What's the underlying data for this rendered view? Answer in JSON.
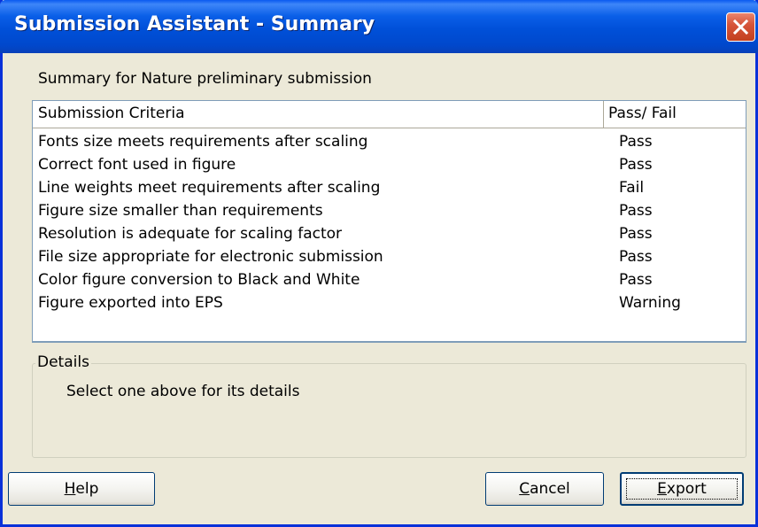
{
  "window": {
    "title": "Submission Assistant - Summary"
  },
  "summary": {
    "label": "Summary for Nature preliminary submission"
  },
  "table": {
    "columns": [
      "Submission Criteria",
      "Pass/ Fail"
    ],
    "rows": [
      {
        "criteria": "Fonts size meets requirements after scaling",
        "result": "Pass"
      },
      {
        "criteria": "Correct font used in figure",
        "result": "Pass"
      },
      {
        "criteria": "Line weights meet requirements after scaling",
        "result": "Fail"
      },
      {
        "criteria": "Figure size smaller than requirements",
        "result": "Pass"
      },
      {
        "criteria": "Resolution is adequate for scaling factor",
        "result": "Pass"
      },
      {
        "criteria": "File size appropriate for electronic submission",
        "result": "Pass"
      },
      {
        "criteria": "Color figure conversion to Black and White",
        "result": "Pass"
      },
      {
        "criteria": "Figure exported into EPS",
        "result": "Warning"
      }
    ]
  },
  "details": {
    "legend": "Details",
    "text": "Select one above for its details"
  },
  "buttons": {
    "help": {
      "mnemonic": "H",
      "rest": "elp"
    },
    "cancel": {
      "mnemonic": "C",
      "rest": "ancel"
    },
    "export": {
      "mnemonic": "E",
      "rest": "xport"
    }
  },
  "icons": {
    "close": "close-icon"
  },
  "colors": {
    "titlebar": "#0054e3",
    "window_border": "#0831d9",
    "close_button": "#d6553a",
    "face": "#ece9d8"
  }
}
